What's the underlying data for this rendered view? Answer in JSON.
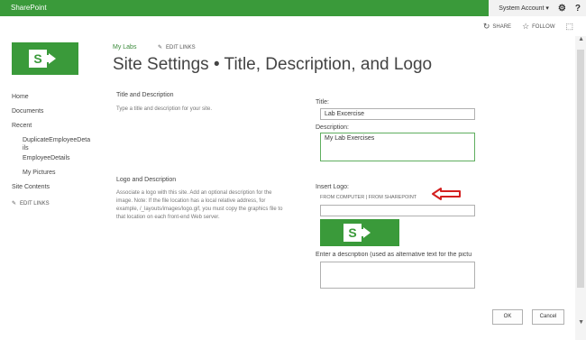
{
  "suitebar": {
    "brand": "SharePoint",
    "account": "System Account ▾",
    "settings_icon": "⚙",
    "help_icon": "?"
  },
  "actionbar": {
    "share_label": "SHARE",
    "follow_label": "FOLLOW",
    "share_icon": "↻",
    "follow_icon": "☆",
    "focus_icon": "⬚"
  },
  "header": {
    "breadcrumb": "My Labs",
    "edit_links": "EDIT LINKS",
    "title": "Site Settings • Title, Description, and Logo"
  },
  "quicklaunch": {
    "items": [
      "Home",
      "Documents",
      "Recent",
      "DuplicateEmployeeDeta",
      "ils",
      "EmployeeDetails",
      "My Pictures",
      "Site Contents"
    ],
    "edit_links": "EDIT LINKS"
  },
  "sections": {
    "title_desc": {
      "heading": "Title and Description",
      "description": "Type a title and description for your site."
    },
    "logo_desc": {
      "heading": "Logo and Description",
      "description_lines": [
        "Associate a logo with this site. Add an optional description for the",
        "image. Note: If the file location has a local relative address, for",
        "example, /_layouts/images/logo.gif, you must copy the graphics file to",
        "that location on each front-end Web server."
      ]
    }
  },
  "form": {
    "title_label": "Title:",
    "title_value": "Lab Excercise",
    "description_label": "Description:",
    "description_value": "My Lab Exercises",
    "insert_logo_label": "Insert Logo:",
    "from_links": "FROM COMPUTER | FROM SHAREPOINT",
    "logo_url_value": "",
    "alt_text_label": "Enter a description (used as alternative text for the pictu",
    "alt_text_value": ""
  },
  "buttons": {
    "ok": "OK",
    "cancel": "Cancel"
  },
  "colors": {
    "brand_green": "#3a9a3a",
    "annotation_red": "#d42020"
  },
  "scrollbar": {
    "up_icon": "▲",
    "down_icon": "▼"
  }
}
